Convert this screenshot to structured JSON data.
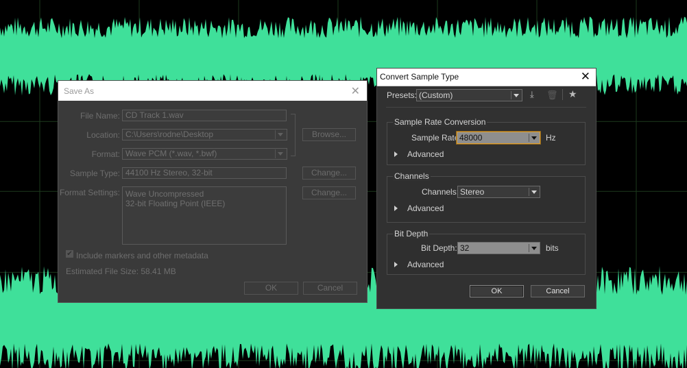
{
  "save_as": {
    "title": "Save As",
    "file_name_label": "File Name:",
    "file_name_value": "CD Track 1.wav",
    "location_label": "Location:",
    "location_value": "C:\\Users\\rodne\\Desktop",
    "browse_label": "Browse...",
    "format_label": "Format:",
    "format_value": "Wave PCM (*.wav, *.bwf)",
    "sample_type_label": "Sample Type:",
    "sample_type_value": "44100 Hz Stereo, 32-bit",
    "change_label": "Change...",
    "format_settings_label": "Format Settings:",
    "format_settings_lines": [
      "Wave Uncompressed",
      "32-bit Floating Point (IEEE)"
    ],
    "include_markers_label": "Include markers and other metadata",
    "include_markers_checked": true,
    "estimated_size": "Estimated File Size: 58.41 MB",
    "ok_label": "OK",
    "cancel_label": "Cancel"
  },
  "convert": {
    "title": "Convert Sample Type",
    "presets_label": "Presets:",
    "presets_value": "(Custom)",
    "sample_rate_group": "Sample Rate Conversion",
    "sample_rate_label": "Sample Rate:",
    "sample_rate_value": "48000",
    "sample_rate_unit": "Hz",
    "advanced_label": "Advanced",
    "channels_group": "Channels",
    "channels_label": "Channels:",
    "channels_value": "Stereo",
    "bit_depth_group": "Bit Depth",
    "bit_depth_label": "Bit Depth:",
    "bit_depth_value": "32",
    "bit_depth_unit": "bits",
    "ok_label": "OK",
    "cancel_label": "Cancel"
  },
  "colors": {
    "waveform": "#3fe09a",
    "background": "#000000",
    "grid": "#1d3a1d"
  },
  "icons": [
    "save-preset-icon",
    "delete-preset-icon",
    "favorite-star-icon",
    "close-icon",
    "dropdown-arrow-icon",
    "disclosure-triangle-icon"
  ]
}
